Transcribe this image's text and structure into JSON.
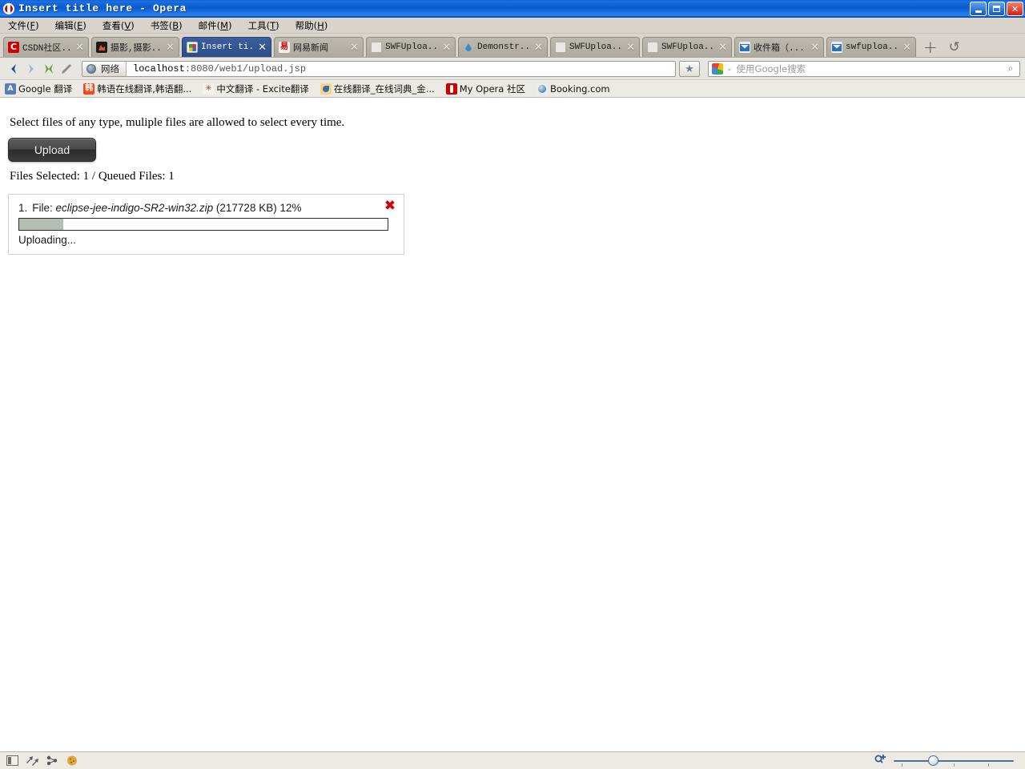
{
  "window": {
    "title": "Insert title here - Opera",
    "controls": {
      "minimize": "minimize-button",
      "maximize": "maximize-button",
      "close": "close-button"
    }
  },
  "menubar": [
    {
      "label": "文件",
      "accel": "F"
    },
    {
      "label": "编辑",
      "accel": "E"
    },
    {
      "label": "查看",
      "accel": "V"
    },
    {
      "label": "书签",
      "accel": "B"
    },
    {
      "label": "邮件",
      "accel": "M"
    },
    {
      "label": "工具",
      "accel": "T"
    },
    {
      "label": "帮助",
      "accel": "H"
    }
  ],
  "tabs": [
    {
      "label": "CSDN社区...",
      "icon": "csdn-icon",
      "active": false
    },
    {
      "label": "摄影,摄影...",
      "icon": "photo-icon",
      "active": false
    },
    {
      "label": "Insert ti...",
      "icon": "page-icon",
      "active": true
    },
    {
      "label": "网易新闻",
      "icon": "netease-icon",
      "active": false
    },
    {
      "label": "SWFUploa...",
      "icon": "blank-page-icon",
      "active": false
    },
    {
      "label": "Demonstr...",
      "icon": "drupal-icon",
      "active": false
    },
    {
      "label": "SWFUploa...",
      "icon": "blank-page-icon",
      "active": false
    },
    {
      "label": "SWFUploa...",
      "icon": "blank-page-icon",
      "active": false
    },
    {
      "label": "收件箱（...",
      "icon": "mail-icon",
      "active": false
    },
    {
      "label": "swfuploa...",
      "icon": "mail-icon",
      "active": false
    }
  ],
  "tabbar": {
    "new_tab": "+",
    "trash": "↺"
  },
  "toolbar": {
    "back": "back-icon",
    "forward": "forward-icon",
    "stop": "stop-icon",
    "edit": "edit-icon",
    "protocol_label": "网络",
    "url_host": "localhost",
    "url_rest": ":8080/web1/upload.jsp",
    "star": "★",
    "search_placeholder": "使用Google搜索",
    "search_value": "",
    "search_caret": "⌄",
    "search_go": "⌕"
  },
  "bookmarks": [
    {
      "label": "Google 翻译",
      "icon": "google-translate-icon"
    },
    {
      "label": "韩语在线翻译,韩语翻...",
      "icon": "korean-translate-icon"
    },
    {
      "label": "中文翻译 - Excite翻译",
      "icon": "excite-icon"
    },
    {
      "label": "在线翻译_在线词典_金...",
      "icon": "dictionary-icon"
    },
    {
      "label": "My Opera 社区",
      "icon": "opera-icon"
    },
    {
      "label": "Booking.com",
      "icon": "booking-icon"
    }
  ],
  "page": {
    "description": "Select files of any type, muliple files are allowed to select every time.",
    "upload_button": "Upload",
    "counts": "Files Selected: 1 / Queued Files: 1",
    "queue": [
      {
        "index": "1.",
        "file_label": "File:",
        "filename": "eclipse-jee-indigo-SR2-win32.zip",
        "size": "(217728 KB)",
        "percent": "12%",
        "progress_value": 12,
        "status": "Uploading...",
        "delete_icon": "✖"
      }
    ]
  },
  "statusbar": {
    "icons": [
      "panels-icon",
      "transfers-icon",
      "links-icon",
      "cookies-icon"
    ],
    "zoom_icon": "zoom-icon",
    "zoom_value": 100
  },
  "colors": {
    "titlebar_blue": "#0a5ad0",
    "active_tab": "#2c4d88",
    "progress_fill": "#b3bfb3",
    "delete_red": "#d40000",
    "chrome_gray": "#d8d4cc"
  }
}
